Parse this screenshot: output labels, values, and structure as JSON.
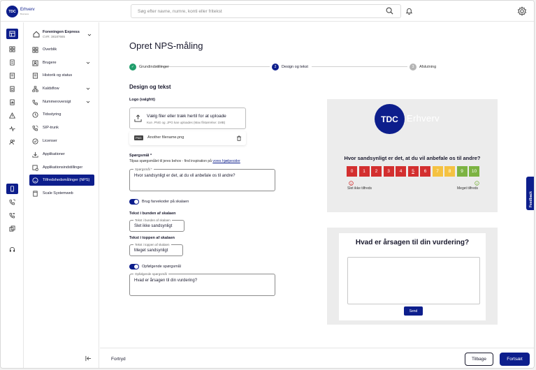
{
  "brand": {
    "logo_text": "TDC",
    "name": "Erhverv",
    "tagline": "Business",
    "primary_color": "#0d1e8c"
  },
  "search": {
    "placeholder": "Søg efter navne, numre, konti eller fritekst"
  },
  "org": {
    "name": "Foreningen Express",
    "cvr": "CVR: 38187665"
  },
  "nav": {
    "items": [
      {
        "label": "Overblik",
        "icon": "grid-icon"
      },
      {
        "label": "Brugere",
        "icon": "users-icon"
      },
      {
        "label": "Historik og status",
        "icon": "history-icon"
      },
      {
        "label": "Kaldsflow",
        "icon": "flow-icon"
      },
      {
        "label": "Nummeroversigt",
        "icon": "numbers-icon"
      },
      {
        "label": "Tidsstyring",
        "icon": "clock-icon"
      },
      {
        "label": "SIP-trunk",
        "icon": "sip-icon"
      },
      {
        "label": "Licenser",
        "icon": "license-icon"
      },
      {
        "label": "Applikationer",
        "icon": "download-icon"
      },
      {
        "label": "Applikationsindstillinger",
        "icon": "app-settings-icon"
      },
      {
        "label": "Tilfredshedsmålinger (NPS)",
        "icon": "smile-icon",
        "active": true
      },
      {
        "label": "Scale Systemweb",
        "icon": "web-icon"
      }
    ]
  },
  "page": {
    "title": "Opret NPS-måling",
    "section_title": "Design og tekst"
  },
  "steps": [
    {
      "number": "✓",
      "label": "Grundindstillinger",
      "state": "done"
    },
    {
      "number": "2",
      "label": "Design og tekst",
      "state": "current"
    },
    {
      "number": "3",
      "label": "Afslutning",
      "state": "pending"
    }
  ],
  "form": {
    "logo_label": "Logo (valgfrit)",
    "upload_main": "Vælg filer eller træk hertil for at uploade",
    "upload_hint": "Kun .PNG og .JPG kan uploades (Max filstørrelse: 1MB)",
    "file_badge": "PNG",
    "file_name": "Another filename.png",
    "question_label": "Spørgsmål *",
    "question_hint": "Tilpas spørgsmålet til jeres behov - find inspiration på ",
    "question_hint_link": "vores hjælpesider",
    "question_legend": "Spørgsmål *",
    "question_value": "Hvor sandsynligt er det, at du vil anbefale os til andre?",
    "colorcode_label": "Brug farvekoder på skalaen",
    "bottom_label": "Tekst i bunden af skalaen",
    "bottom_legend": "Tekst i bunden af skalaen",
    "bottom_value": "Slet ikke sandsynligt",
    "top_label": "Tekst i toppen af skalaen",
    "top_legend": "Tekst i toppen af skalaen",
    "top_value": "Meget sandsynligt",
    "followup_toggle": "Opfølgende spørgsmål",
    "followup_legend": "Opfølgende spørgsmål",
    "followup_value": "Hvad er årsagen til din vurdering?"
  },
  "preview": {
    "logo_text": "TDC",
    "logo_word": "Erhverv",
    "question": "Hvor sandsynligt er det, at du vil anbefale os til andre?",
    "scale": [
      "0",
      "1",
      "2",
      "3",
      "4",
      "5",
      "6",
      "7",
      "8",
      "9",
      "10"
    ],
    "scale_colors": [
      "#d32f2f",
      "#d32f2f",
      "#d32f2f",
      "#d32f2f",
      "#d32f2f",
      "#d32f2f",
      "#d32f2f",
      "#f5c242",
      "#f5c242",
      "#7cb342",
      "#7cb342"
    ],
    "low_text": "Slet ikke tilfreds",
    "high_text": "Meget tilfreds",
    "followup_question": "Hvad er årsagen til din vurdering?",
    "send_label": "Send"
  },
  "footer": {
    "cancel": "Fortryd",
    "back": "Tilbage",
    "next": "Fortsæt"
  },
  "feedback_tab": "Feedback"
}
